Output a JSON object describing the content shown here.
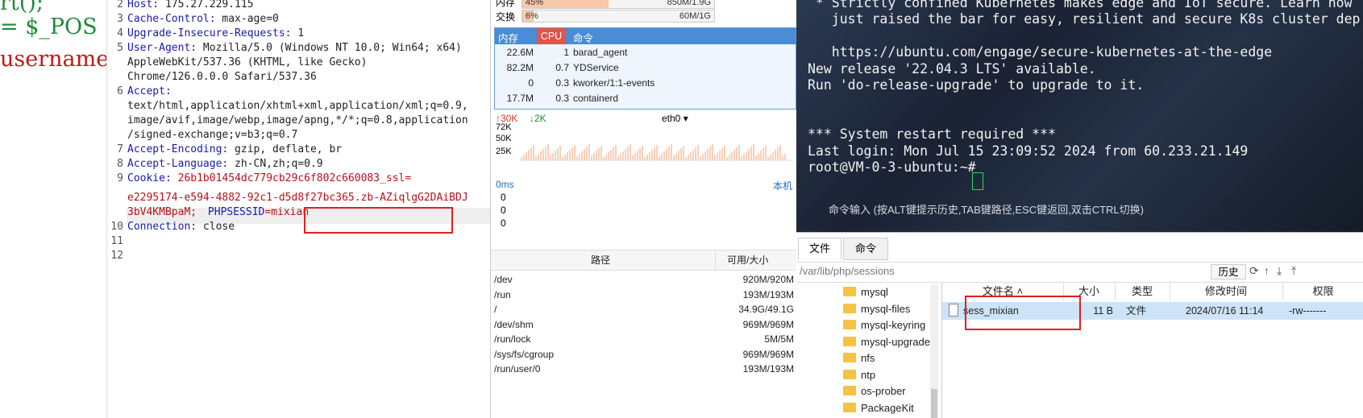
{
  "code_pane": {
    "line1": "rt();",
    "line2": "=  $_POS",
    "line3": "username"
  },
  "request": {
    "lines": [
      {
        "n": "2",
        "key": "Host:",
        "val": " 175.27.229.115"
      },
      {
        "n": "3",
        "key": "Cache-Control:",
        "val": " max-age=0"
      },
      {
        "n": "4",
        "key": "Upgrade-Insecure-Requests:",
        "val": " 1"
      },
      {
        "n": "5",
        "key": "User-Agent:",
        "val": " Mozilla/5.0 (Windows NT 10.0; Win64; x64)"
      },
      {
        "n": "",
        "key": "",
        "val": "AppleWebKit/537.36 (KHTML, like Gecko)"
      },
      {
        "n": "",
        "key": "",
        "val": "Chrome/126.0.0.0 Safari/537.36"
      },
      {
        "n": "6",
        "key": "Accept:",
        "val": ""
      },
      {
        "n": "",
        "key": "",
        "val": "text/html,application/xhtml+xml,application/xml;q=0.9,"
      },
      {
        "n": "",
        "key": "",
        "val": "image/avif,image/webp,image/apng,*/*;q=0.8,application"
      },
      {
        "n": "",
        "key": "",
        "val": "/signed-exchange;v=b3;q=0.7"
      },
      {
        "n": "7",
        "key": "Accept-Encoding:",
        "val": " gzip, deflate, br"
      },
      {
        "n": "8",
        "key": "Accept-Language:",
        "val": " zh-CN,zh;q=0.9"
      },
      {
        "n": "9",
        "key": "Cookie:",
        "val": " 26b1b01454dc779cb29c6f802c660083_ssl="
      }
    ],
    "cookie_cont1": "e2295174-e594-4882-92c1-d5d8f27bc365.zb-AZiqlgG2DAiBDJ",
    "cookie_cont2a": "3bV4KMBpaM;",
    "cookie_cont2b_key": "PHPSESSID",
    "cookie_cont2b_val": "=mixian",
    "line10_n": "10",
    "line10_key": "Connection:",
    "line10_val": " close",
    "line11_n": "11",
    "line12_n": "12"
  },
  "monitor": {
    "top_label": "内存",
    "top_value": "850M/1.9G",
    "top_pct": "45%",
    "top_fill": 0.45,
    "swap_label": "交换",
    "swap_pct": "6%",
    "swap_value": "60M/1G",
    "swap_fill": 0.06,
    "proc_headers": {
      "mem": "内存",
      "cpu": "CPU",
      "cmd": "命令"
    },
    "procs": [
      {
        "mem": "22.6M",
        "cpu": "1",
        "cmd": "barad_agent"
      },
      {
        "mem": "82.2M",
        "cpu": "0.7",
        "cmd": "YDService"
      },
      {
        "mem": "0",
        "cpu": "0.3",
        "cmd": "kworker/1:1-events"
      },
      {
        "mem": "17.7M",
        "cpu": "0.3",
        "cmd": "containerd"
      }
    ],
    "net": {
      "up": "30K",
      "down": "2K",
      "iface": "eth0",
      "y_ticks": [
        "72K",
        "50K",
        "25K"
      ]
    },
    "latency": {
      "unit": "0ms",
      "host": "本机",
      "values": [
        "0",
        "0",
        "0"
      ]
    },
    "disk_headers": {
      "path": "路径",
      "size": "可用/大小"
    },
    "disks": [
      {
        "path": "/dev",
        "size": "920M/920M"
      },
      {
        "path": "/run",
        "size": "193M/193M"
      },
      {
        "path": "/",
        "size": "34.9G/49.1G"
      },
      {
        "path": "/dev/shm",
        "size": "969M/969M"
      },
      {
        "path": "/run/lock",
        "size": "5M/5M"
      },
      {
        "path": "/sys/fs/cgroup",
        "size": "969M/969M"
      },
      {
        "path": "/run/user/0",
        "size": "193M/193M"
      }
    ]
  },
  "terminal": {
    "lines": [
      " * Strictly confined Kubernetes makes edge and IoT secure. Learn how",
      "   just raised the bar for easy, resilient and secure K8s cluster dep",
      "",
      "   https://ubuntu.com/engage/secure-kubernetes-at-the-edge",
      "New release '22.04.3 LTS' available.",
      "Run 'do-release-upgrade' to upgrade to it.",
      "",
      "",
      "*** System restart required ***",
      "Last login: Mon Jul 15 23:09:52 2024 from 60.233.21.149",
      "root@VM-0-3-ubuntu:~# "
    ],
    "hint": "命令输入 (按ALT键提示历史,TAB键路径,ESC键返回,双击CTRL切换)"
  },
  "files": {
    "tab_files": "文件",
    "tab_cmd": "命令",
    "path": "/var/lib/php/sessions",
    "history_btn": "历史",
    "folders": [
      "mysql",
      "mysql-files",
      "mysql-keyring",
      "mysql-upgrade",
      "nfs",
      "ntp",
      "os-prober",
      "PackageKit"
    ],
    "headers": {
      "name": "文件名",
      "size": "大小",
      "type": "类型",
      "mtime": "修改时间",
      "perm": "权限"
    },
    "rows": [
      {
        "name": "sess_mixian",
        "size": "11 B",
        "type": "文件",
        "mtime": "2024/07/16 11:14",
        "perm": "-rw-------"
      }
    ]
  },
  "colors": {
    "accent": "#4a8cd6",
    "highlight_box": "#e02020",
    "terminal_cursor": "#3ad06a"
  }
}
